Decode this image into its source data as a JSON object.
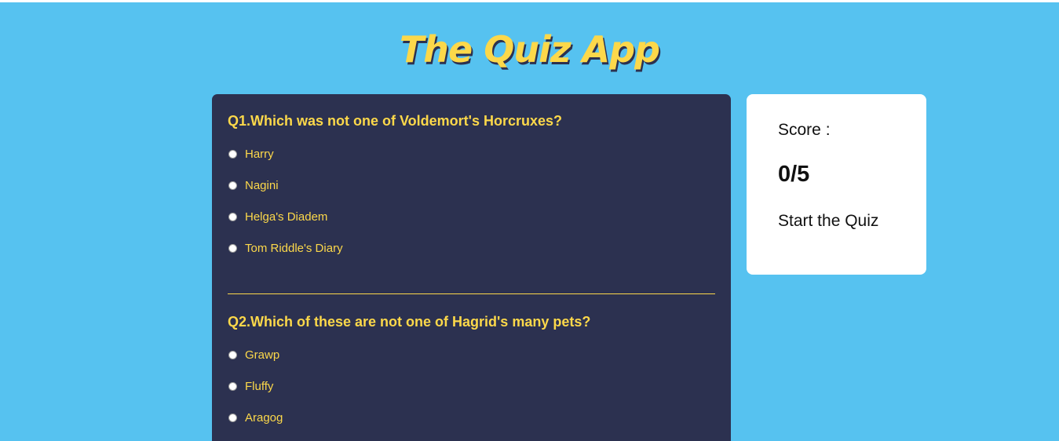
{
  "app": {
    "title": "The Quiz App",
    "colors": {
      "background": "#56c2f0",
      "panel": "#2c3150",
      "accent": "#fcd84a",
      "card": "#ffffff"
    }
  },
  "questions": [
    {
      "text": "Q1.Which was not one of Voldemort's Horcruxes?",
      "options": [
        "Harry",
        "Nagini",
        "Helga's Diadem",
        "Tom Riddle's Diary"
      ]
    },
    {
      "text": "Q2.Which of these are not one of Hagrid's many pets?",
      "options": [
        "Grawp",
        "Fluffy",
        "Aragog"
      ]
    }
  ],
  "score": {
    "label": "Score :",
    "value": "0/5",
    "status": "Start the Quiz"
  }
}
